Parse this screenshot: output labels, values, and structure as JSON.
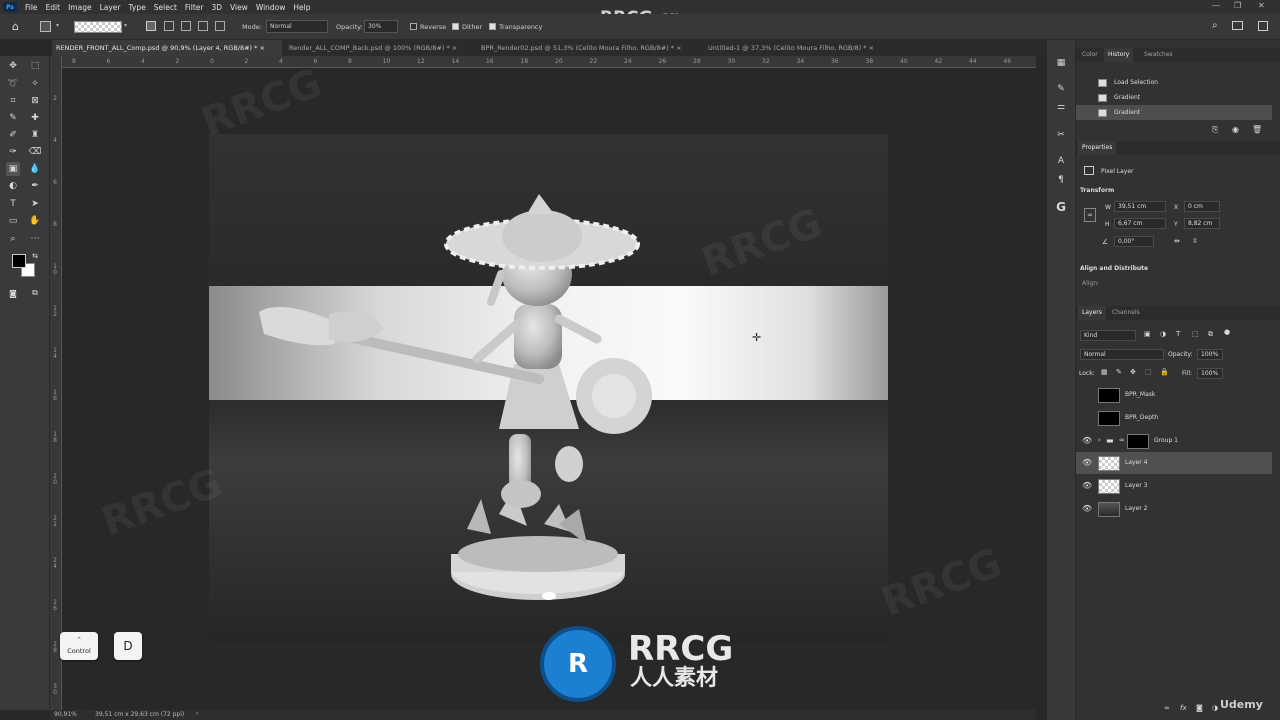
{
  "app": {
    "logo": "Ps"
  },
  "menu": [
    "File",
    "Edit",
    "Image",
    "Layer",
    "Type",
    "Select",
    "Filter",
    "3D",
    "View",
    "Window",
    "Help"
  ],
  "watermark_top": "RRCG.cn",
  "options": {
    "mode_label": "Mode:",
    "mode_value": "Normal",
    "opacity_label": "Opacity:",
    "opacity_value": "30%",
    "reverse": "Reverse",
    "dither": "Dither",
    "transparency": "Transparency"
  },
  "tabs": [
    "RENDER_FRONT_ALL_Comp.psd @ 90,9% (Layer 4, RGB/8#) *",
    "Render_ALL_COMP_Back.psd @ 100% (RGB/8#) *",
    "BPR_Render02.psd @ 51,3% (Celito Moura Filho, RGB/8#) *",
    "Untitled-1 @ 37,3% (Celito Moura Filho, RGB/8) *"
  ],
  "ruler_h": [
    "8",
    "6",
    "4",
    "2",
    "0",
    "2",
    "4",
    "6",
    "8",
    "10",
    "12",
    "14",
    "16",
    "18",
    "20",
    "22",
    "24",
    "26",
    "28",
    "30",
    "32",
    "34",
    "36",
    "38",
    "40",
    "42",
    "44",
    "46"
  ],
  "ruler_v": [
    "2",
    "4",
    "6",
    "8",
    "1 0",
    "1 2",
    "1 4",
    "1 6",
    "1 8",
    "2 0",
    "2 2",
    "2 4",
    "2 6",
    "2 8",
    "3 0"
  ],
  "status": {
    "zoom": "90,91%",
    "doc": "39,51 cm x 29,63 cm (72 ppi)"
  },
  "keys": {
    "control": "Control",
    "d": "D"
  },
  "brand": {
    "title": "RRCG",
    "subtitle": "人人素材"
  },
  "history": {
    "tabs": [
      "Color",
      "History",
      "Swatches"
    ],
    "items": [
      "Load Selection",
      "Gradient",
      "Gradient"
    ]
  },
  "properties": {
    "title": "Properties",
    "kind": "Pixel Layer",
    "transform_label": "Transform",
    "w_label": "W",
    "w": "39,51 cm",
    "x_label": "X",
    "x": "0 cm",
    "h_label": "H",
    "h": "6,67 cm",
    "y_label": "Y",
    "y": "8,82 cm",
    "angle": "0,00°",
    "align_label": "Align and Distribute",
    "align_sub": "Align:"
  },
  "layers": {
    "tabs": [
      "Layers",
      "Channels"
    ],
    "kind": "Kind",
    "blend": "Normal",
    "opacity_label": "Opacity:",
    "opacity": "100%",
    "lock_label": "Lock:",
    "fill_label": "Fill:",
    "fill": "100%",
    "items": [
      {
        "name": "BPR_Mask"
      },
      {
        "name": "BPR_Depth"
      },
      {
        "name": "Group 1"
      },
      {
        "name": "Layer 4"
      },
      {
        "name": "Layer 3"
      },
      {
        "name": "Layer 2"
      }
    ]
  },
  "udemy": "Udemy"
}
